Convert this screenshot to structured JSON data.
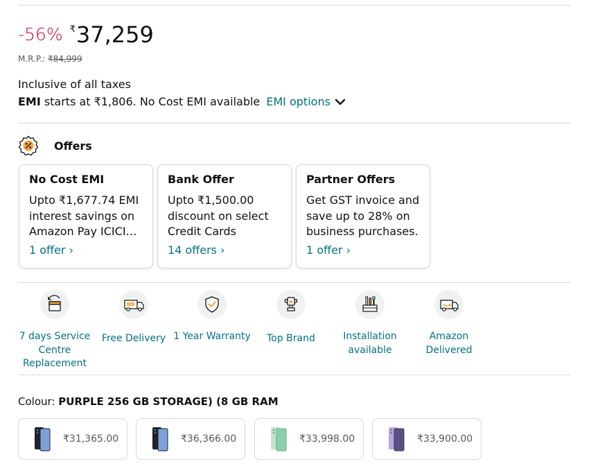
{
  "price": {
    "discount": "-56%",
    "currency": "₹",
    "amount": "37,259",
    "mrp_label": "M.R.P.:",
    "mrp_value": "₹84,999",
    "taxes": "Inclusive of all taxes",
    "emi_bold": "EMI",
    "emi_text": "starts at ₹1,806. No Cost EMI available",
    "emi_link": "EMI options"
  },
  "offers": {
    "heading": "Offers",
    "cards": [
      {
        "title": "No Cost EMI",
        "body": "Upto ₹1,677.74 EMI interest savings on Amazon Pay ICICI…",
        "link": "1 offer ›"
      },
      {
        "title": "Bank Offer",
        "body": "Upto ₹1,500.00 discount on select Credit Cards",
        "link": "14 offers ›"
      },
      {
        "title": "Partner Offers",
        "body": "Get GST invoice and save up to 28% on business purchases.",
        "link": "1 offer ›"
      }
    ]
  },
  "features": [
    {
      "label": "7 days Service Centre Replacement",
      "icon": "replacement-icon"
    },
    {
      "label": "Free Delivery",
      "icon": "free-delivery-truck-icon"
    },
    {
      "label": "1 Year Warranty",
      "icon": "warranty-shield-icon"
    },
    {
      "label": "Top Brand",
      "icon": "trophy-icon"
    },
    {
      "label": "Installation available",
      "icon": "installation-tools-icon"
    },
    {
      "label": "Amazon Delivered",
      "icon": "amazon-van-icon"
    }
  ],
  "colour": {
    "label": "Colour:",
    "value": "PURPLE 256 GB STORAGE) (8 GB RAM"
  },
  "variants": [
    {
      "price": "₹31,365.00",
      "color": "#2a2f3a",
      "icon": "phone-graphite-icon"
    },
    {
      "price": "₹36,366.00",
      "color": "#2a2f3a",
      "icon": "phone-graphite-icon"
    },
    {
      "price": "₹33,998.00",
      "color": "#bfe3d0",
      "icon": "phone-mint-icon"
    },
    {
      "price": "₹33,900.00",
      "color": "#b8a8d8",
      "icon": "phone-purple-icon"
    }
  ],
  "colors": {
    "discount": "#cc0c39",
    "link": "#007185",
    "text": "#0f1111",
    "muted": "#565959",
    "border": "#d5d9d9"
  }
}
